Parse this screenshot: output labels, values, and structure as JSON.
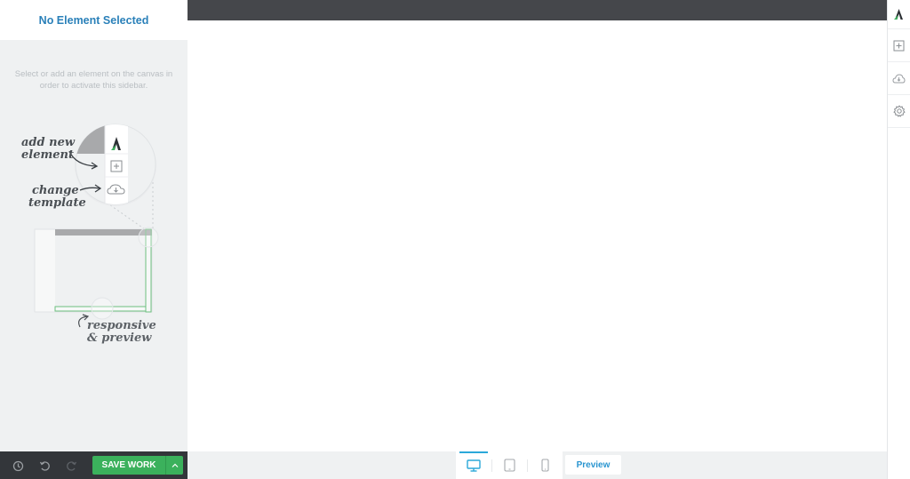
{
  "sidebar": {
    "title": "No Element Selected",
    "hint": "Select or add an element on the canvas in order to activate this sidebar.",
    "illustration": {
      "label_add": "add new element",
      "label_add_line1": "add new",
      "label_add_line2": "element",
      "label_template_line1": "change",
      "label_template_line2": "template",
      "label_responsive_line1": "responsive",
      "label_responsive_line2": "& preview"
    }
  },
  "bottom_toolbar": {
    "history_icon": "clock-icon",
    "undo_icon": "undo-icon",
    "redo_icon": "redo-icon",
    "save_label": "SAVE WORK",
    "save_more_icon": "chevron-up-icon"
  },
  "device_bar": {
    "devices": [
      {
        "name": "desktop",
        "icon": "desktop-icon",
        "active": true
      },
      {
        "name": "tablet",
        "icon": "tablet-icon",
        "active": false
      },
      {
        "name": "mobile",
        "icon": "mobile-icon",
        "active": false
      }
    ],
    "preview_label": "Preview"
  },
  "right_bar": {
    "items": [
      {
        "name": "logo",
        "icon": "brand-logo-icon"
      },
      {
        "name": "add-element",
        "icon": "plus-square-icon"
      },
      {
        "name": "templates",
        "icon": "cloud-download-icon"
      },
      {
        "name": "settings",
        "icon": "gear-icon"
      }
    ]
  },
  "colors": {
    "accent_blue": "#2a80b9",
    "save_green": "#3bb15c",
    "active_device": "#2ba8d9",
    "dark_bar": "#45474b",
    "sidebar_bg": "#eff1f2"
  }
}
